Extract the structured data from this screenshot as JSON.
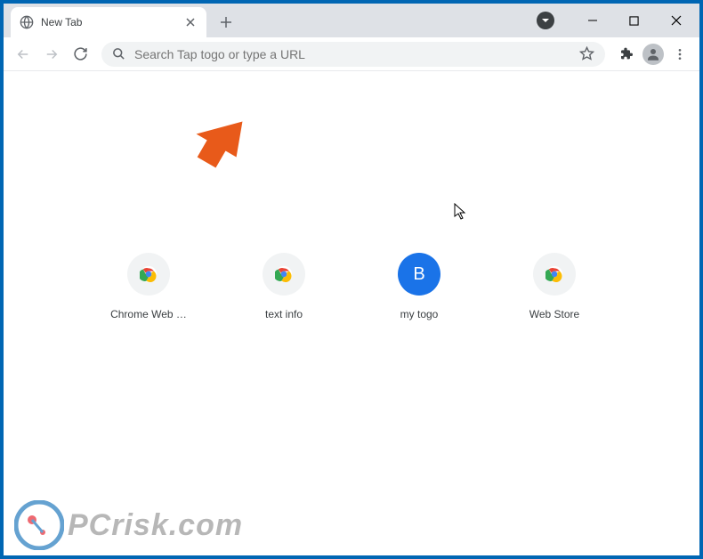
{
  "tab": {
    "title": "New Tab"
  },
  "omnibox": {
    "placeholder": "Search Tap togo or type a URL"
  },
  "shortcuts": [
    {
      "label": "Chrome Web …",
      "type": "chrome"
    },
    {
      "label": "text info",
      "type": "chrome"
    },
    {
      "label": "my togo",
      "type": "letter",
      "letter": "B"
    },
    {
      "label": "Web Store",
      "type": "chrome"
    }
  ],
  "watermark": {
    "text": "PCrisk.com"
  }
}
